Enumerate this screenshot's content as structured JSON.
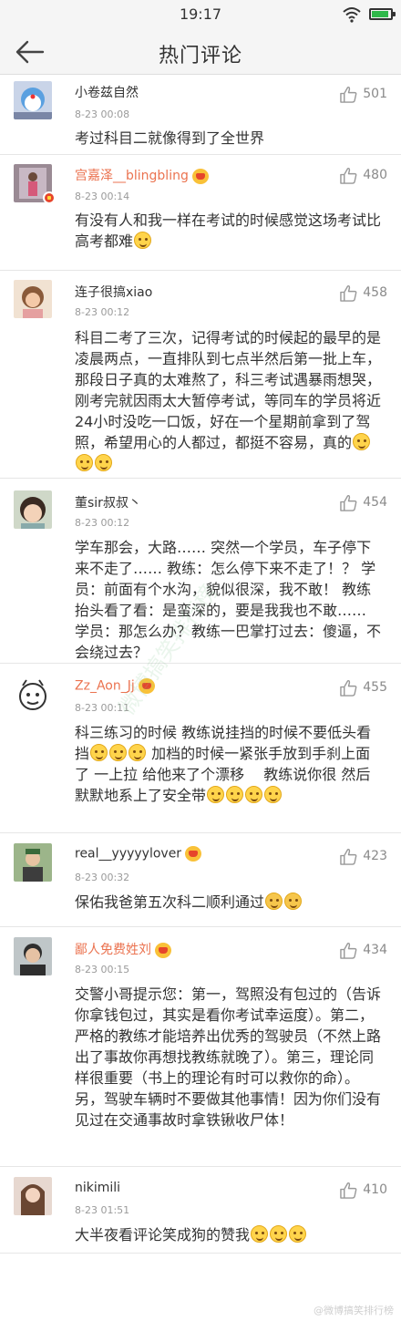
{
  "status_bar": {
    "time": "19:17"
  },
  "header": {
    "title": "热门评论"
  },
  "comments": [
    {
      "user": "小卷兹自然",
      "time": "8-23 00:08",
      "likes": "501",
      "text": "考过科目二就像得到了全世界"
    },
    {
      "user": "宫嘉泽__blingbling",
      "time": "8-23 00:14",
      "likes": "480",
      "text": "有没有人和我一样在考试的时候感觉这场考试比高考都难"
    },
    {
      "user": "连子很搞xiao",
      "time": "8-23 00:12",
      "likes": "458",
      "text": "科目二考了三次，记得考试的时候起的最早的是凌晨两点，一直排队到七点半然后第一批上车，那段日子真的太难熬了，科三考试遇暴雨想哭，刚考完就因雨太大暂停考试，等同车的学员将近24小时没吃一口饭，好在一个星期前拿到了驾照，希望用心的人都过，都挺不容易，真的"
    },
    {
      "user": "董sir叔叔丶",
      "time": "8-23 00:12",
      "likes": "454",
      "text": "学车那会，大路…… 突然一个学员，车子停下来不走了…… 教练：怎么停下来不走了！？ 学员：前面有个水沟，貌似很深，我不敢！ 教练抬头看了看：是蛮深的，要是我我也不敢…… 学员：那怎么办？教练一巴掌打过去：傻逼，不会绕过去？"
    },
    {
      "user": "Zz_Aon_Jj",
      "time": "8-23 00:11",
      "likes": "455",
      "text_a": "科三练习的时候 教练说挂挡的时候不要低头看挡",
      "text_b": " 加档的时候一紧张手放到手刹上面了 一上拉 给他来了个漂移　 教练说你很 然后默默地系上了安全带"
    },
    {
      "user": "real__yyyyylover",
      "time": "8-23 00:32",
      "likes": "423",
      "text": "保佑我爸第五次科二顺利通过"
    },
    {
      "user": "鄙人免费姓刘",
      "time": "8-23 00:15",
      "likes": "434",
      "text": "交警小哥提示您：第一，驾照没有包过的（告诉你拿钱包过，其实是看你考试幸运度）。第二，严格的教练才能培养出优秀的驾驶员（不然上路出了事故你再想找教练就晚了）。第三，理论同样很重要（书上的理论有时可以救你的命）。另，驾驶车辆时不要做其他事情！因为你们没有见过在交通事故时拿铁锹收尸体！"
    },
    {
      "user": "nikimili",
      "time": "8-23 01:51",
      "likes": "410",
      "text": "大半夜看评论笑成狗的赞我"
    }
  ],
  "watermarks": {
    "bottom": "@微博搞笑排行榜",
    "middle": "微博搞笑排行榜"
  },
  "colors": {
    "vip_name": "#eb7350",
    "badge_red": "#e6452b",
    "text": "#333333",
    "meta": "#9a9a9a"
  },
  "icons": {
    "back": "back-arrow-icon",
    "like": "thumb-up-icon",
    "emoji": "emoji-icon"
  }
}
